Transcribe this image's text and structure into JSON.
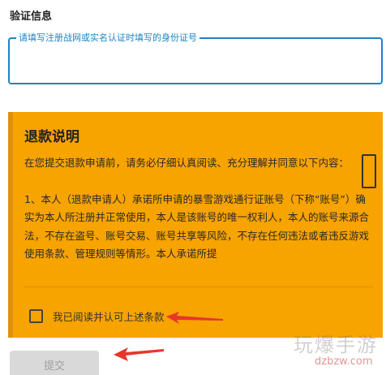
{
  "section_title": "验证信息",
  "id_field": {
    "label": "请填写注册战网或实名认证时填写的身份证号",
    "value": ""
  },
  "refund": {
    "title": "退款说明",
    "paragraph1": "在您提交退款申请前，请务必仔细认真阅读、充分理解并同意以下内容：",
    "paragraph2": "1、本人（退款申请人）承诺所申请的暴雪游戏通行证账号（下称“账号”）确实为本人所注册并正常使用，本人是该账号的唯一权利人，本人的账号来源合法，不存在盗号、账号交易、账号共享等风险，不存在任何违法或者违反游戏使用条款、管理规则等情形。本人承诺所提",
    "agree_label": "我已阅读并认可上述条款"
  },
  "submit_label": "提交",
  "watermark": {
    "text": "玩爆手游",
    "url": "dzbzw.com"
  },
  "colors": {
    "accent": "#1b84c4",
    "notice_bg": "#f7a300",
    "annotation_arrow": "#e8352b"
  }
}
